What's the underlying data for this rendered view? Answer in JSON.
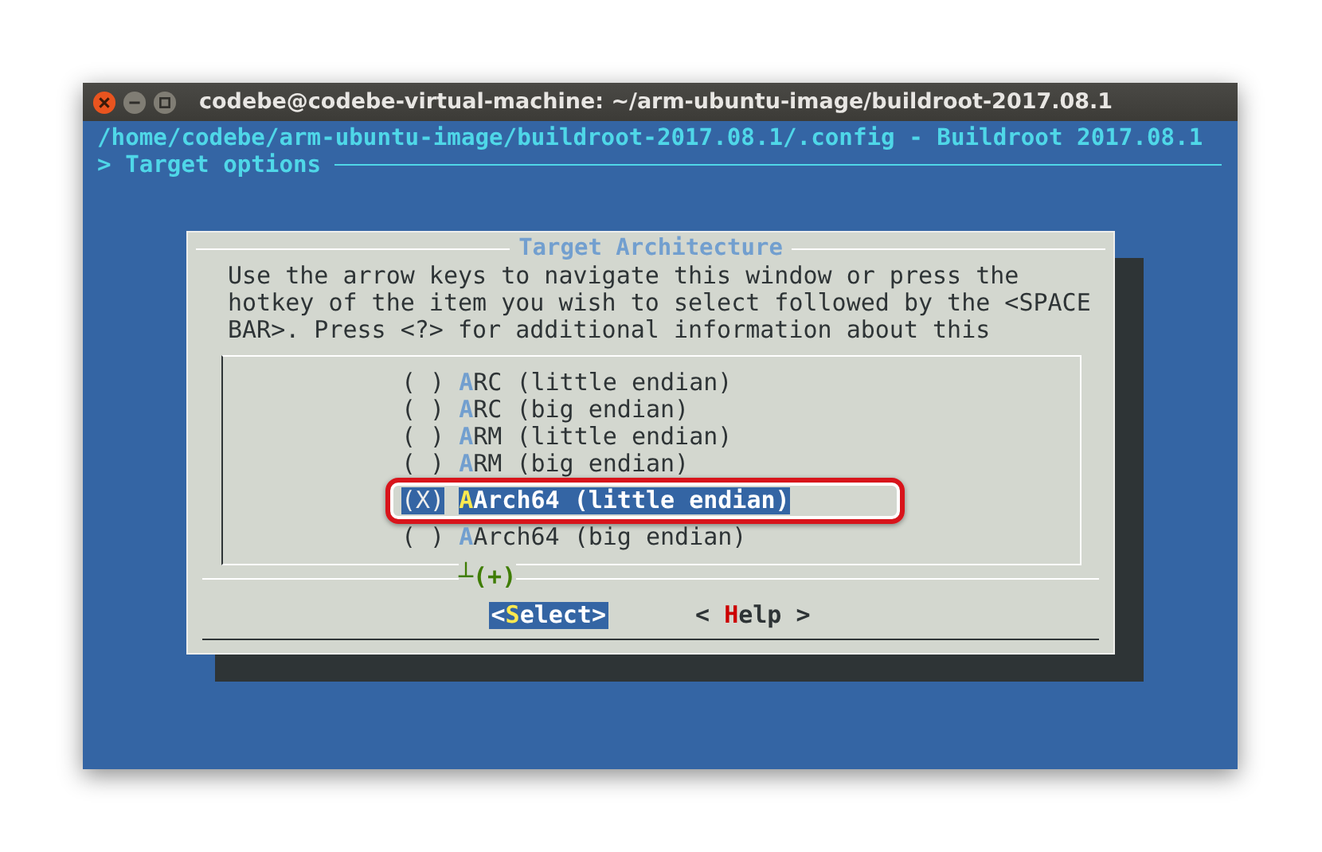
{
  "window": {
    "title": "codebe@codebe-virtual-machine: ~/arm-ubuntu-image/buildroot-2017.08.1"
  },
  "header": {
    "path": "/home/codebe/arm-ubuntu-image/buildroot-2017.08.1/.config - Buildroot 2017.08.1",
    "breadcrumb": "> Target options"
  },
  "dialog": {
    "title": "Target Architecture",
    "help": [
      "Use the arrow keys to navigate this window or press the",
      "hotkey of the item you wish to select followed by the <SPACE",
      "BAR>. Press <?> for additional information about this"
    ],
    "options": [
      {
        "mark": "( )",
        "hotkey": "A",
        "label": "RC (little endian)",
        "selected": false
      },
      {
        "mark": "( )",
        "hotkey": "A",
        "label": "RC (big endian)",
        "selected": false
      },
      {
        "mark": "( )",
        "hotkey": "A",
        "label": "RM (little endian)",
        "selected": false
      },
      {
        "mark": "( )",
        "hotkey": "A",
        "label": "RM (big endian)",
        "selected": false
      },
      {
        "mark": "(X)",
        "hotkey": "A",
        "label": "Arch64 (little endian)",
        "selected": true
      },
      {
        "mark": "( )",
        "hotkey": "A",
        "label": "Arch64 (big endian)",
        "selected": false
      }
    ],
    "more": "┴(+)",
    "buttons": [
      {
        "prefix": "<",
        "hotkey": "S",
        "suffix": "elect>",
        "kind": "primary",
        "selected": true
      },
      {
        "prefix": "< ",
        "hotkey": "H",
        "suffix": "elp >",
        "kind": "help",
        "selected": false
      }
    ]
  }
}
